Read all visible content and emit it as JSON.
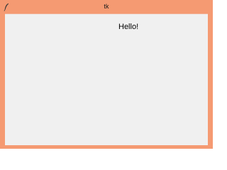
{
  "window": {
    "title": "tk",
    "icon": "feather-icon",
    "accent_color": "#f59a72",
    "client_background": "#f0f0f0"
  },
  "content": {
    "label_text": "Hello!"
  }
}
